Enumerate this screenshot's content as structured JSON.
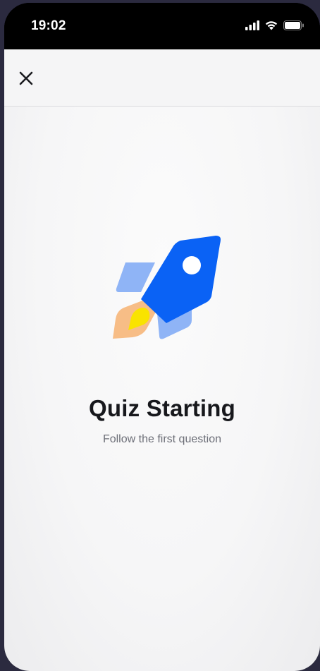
{
  "status_bar": {
    "time": "19:02",
    "icons": [
      "signal-icon",
      "wifi-icon",
      "battery-icon"
    ]
  },
  "nav": {
    "close_icon": "close-icon"
  },
  "main": {
    "illustration": "rocket-icon",
    "title": "Quiz Starting",
    "subtitle": "Follow the first question"
  },
  "colors": {
    "rocket_body": "#0a62f5",
    "rocket_fins": "#8fb4f6",
    "flame_outer": "#f7bd86",
    "flame_inner": "#f9e300",
    "title": "#17181c",
    "subtitle": "#6d6f78"
  }
}
